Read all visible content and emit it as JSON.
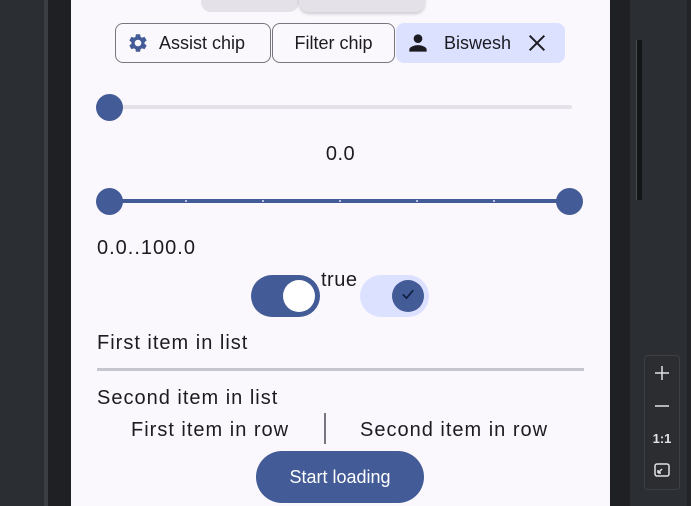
{
  "chips": {
    "assist_label": "Assist chip",
    "assist_icon": "gear-icon",
    "filter_label": "Filter chip",
    "input_label": "Biswesh",
    "input_icon": "person-icon",
    "input_close_icon": "close-icon"
  },
  "slider": {
    "value": 0.0,
    "value_label": "0.0"
  },
  "range_slider": {
    "start": 0.0,
    "end": 100.0,
    "label": "0.0..100.0"
  },
  "switches": {
    "label": "true",
    "switch_1_checked": true,
    "switch_2_checked": true,
    "check_icon": "check-icon"
  },
  "list": {
    "first_item": "First item in list",
    "second_item": "Second item in list"
  },
  "row": {
    "first_item": "First item in row",
    "second_item": "Second item in row"
  },
  "button": {
    "label": "Start loading"
  },
  "zoom_controls": {
    "zoom_in_icon": "plus-icon",
    "zoom_out_icon": "minus-icon",
    "actual_size_label": "1:1",
    "fit_icon": "fit-screen-icon"
  },
  "colors": {
    "primary": "#435b96",
    "primary_container": "#dce1ff",
    "surface": "#fbf8fd",
    "outline": "#75767f",
    "inactive_track": "#e4e1e9"
  }
}
